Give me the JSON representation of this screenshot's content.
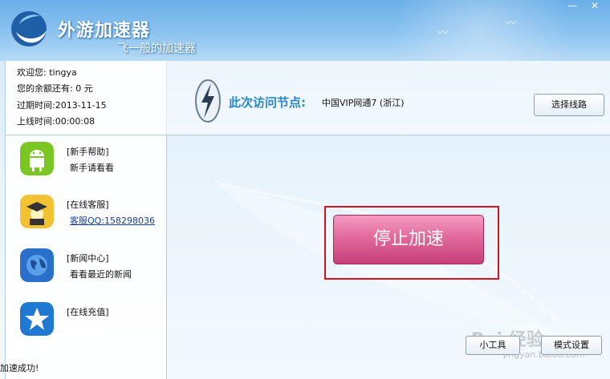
{
  "app": {
    "title": "外游加速器",
    "subtitle": "飞一般的加速器"
  },
  "window_controls": {
    "minimize": "—",
    "close": "✕"
  },
  "user": {
    "welcome": "欢迎您: tingya",
    "balance": "您的余额还有: 0 元",
    "expire": "过期时间:2013-11-15",
    "online": "上线时间:00:00:08"
  },
  "nav": [
    {
      "title": "[新手帮助]",
      "sub": "新手请看看",
      "icon": "android-icon"
    },
    {
      "title": "[在线客服]",
      "sub": "客服QQ:158298036",
      "icon": "graduate-icon"
    },
    {
      "title": "[新闻中心]",
      "sub": "看看最近的新闻",
      "icon": "globe-icon"
    },
    {
      "title": "[在线充值]",
      "sub": "",
      "icon": "star-icon"
    }
  ],
  "status": "加速成功!",
  "node": {
    "label": "此次访问节点:",
    "value": "中国VIP网通7 (浙江)"
  },
  "buttons": {
    "select_route": "选择线路",
    "stop": "停止加速",
    "tool": "小工具",
    "mode": "模式设置"
  },
  "watermark": {
    "text": "Bai 经验",
    "url": "jingyan.baidu.com"
  },
  "colors": {
    "accent": "#2788c7",
    "stop_button": "#e26a9b",
    "highlight_border": "#d4141c"
  }
}
